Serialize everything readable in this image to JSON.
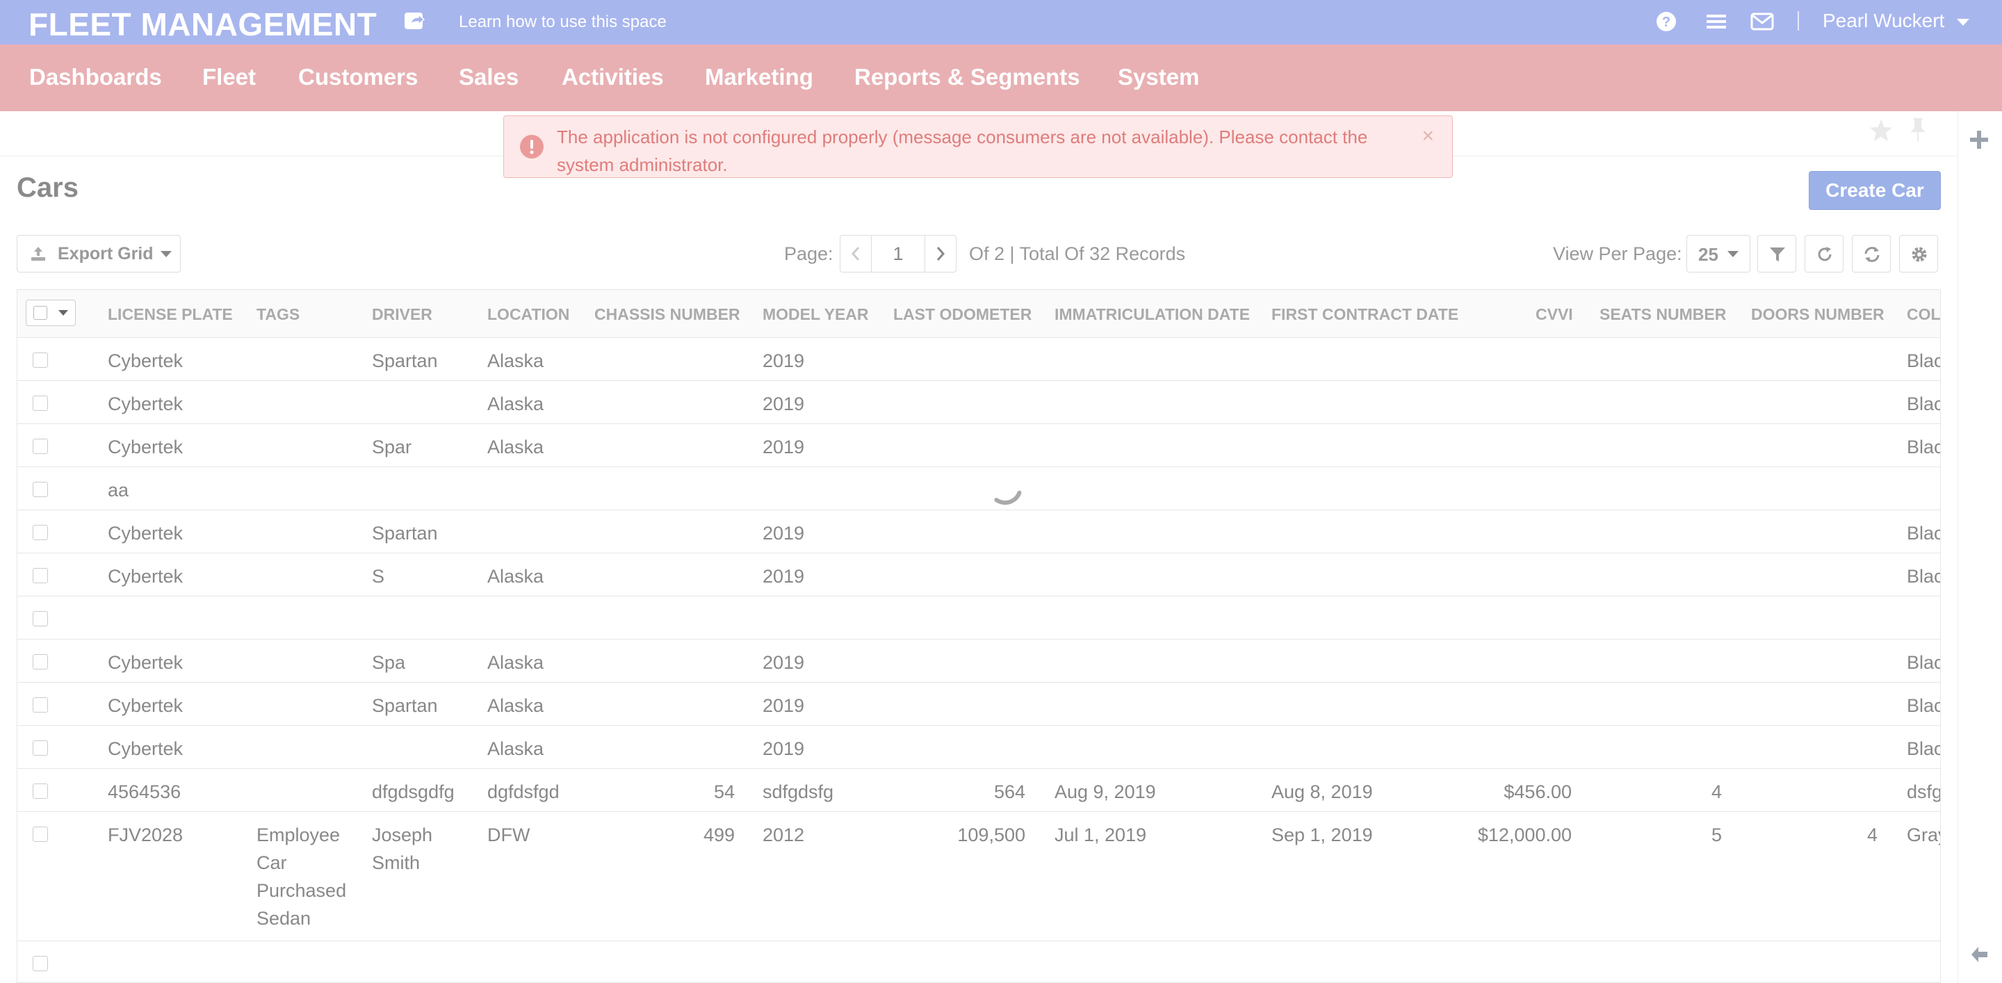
{
  "app": {
    "brand": "FLEET MANAGEMENT",
    "help_link": "Learn how to use this space",
    "user_name": "Pearl Wuckert",
    "icons": [
      "share-icon",
      "question-icon",
      "menu-icon",
      "envelope-icon",
      "caret-down-icon"
    ]
  },
  "nav": {
    "items": [
      "Dashboards",
      "Fleet",
      "Customers",
      "Sales",
      "Activities",
      "Marketing",
      "Reports & Segments",
      "System"
    ]
  },
  "alert": {
    "text": "The application is not configured properly (message consumers are not available). Please contact the system administrator.",
    "close": "×",
    "color": "#e07c7c"
  },
  "page": {
    "title": "Cars",
    "create_button": "Create Car"
  },
  "toolbar": {
    "export_label": "Export Grid",
    "page_label": "Page:",
    "page_value": "1",
    "page_total": "Of 2 | Total Of 32 Records",
    "view_per_page_label": "View Per Page:",
    "view_per_page_value": "25"
  },
  "grid": {
    "columns": [
      "LICENSE PLATE",
      "TAGS",
      "DRIVER",
      "LOCATION",
      "CHASSIS NUMBER",
      "MODEL YEAR",
      "LAST ODOMETER",
      "IMMATRICULATION DATE",
      "FIRST CONTRACT DATE",
      "CVVI",
      "SEATS NUMBER",
      "DOORS NUMBER",
      "COL"
    ],
    "rows": [
      [
        "Cybertek",
        "",
        "Spartan",
        "Alaska",
        "",
        "2019",
        "",
        "",
        "",
        "",
        "",
        "",
        "Blac"
      ],
      [
        "Cybertek",
        "",
        "",
        "Alaska",
        "",
        "2019",
        "",
        "",
        "",
        "",
        "",
        "",
        "Blac"
      ],
      [
        "Cybertek",
        "",
        "Spar",
        "Alaska",
        "",
        "2019",
        "",
        "",
        "",
        "",
        "",
        "",
        "Blac"
      ],
      [
        "aa",
        "",
        "",
        "",
        "",
        "",
        "",
        "",
        "",
        "",
        "",
        "",
        ""
      ],
      [
        "Cybertek",
        "",
        "Spartan",
        "",
        "",
        "2019",
        "",
        "",
        "",
        "",
        "",
        "",
        "Blac"
      ],
      [
        "Cybertek",
        "",
        "S",
        "Alaska",
        "",
        "2019",
        "",
        "",
        "",
        "",
        "",
        "",
        "Blac"
      ],
      [
        "",
        "",
        "",
        "",
        "",
        "",
        "",
        "",
        "",
        "",
        "",
        "",
        ""
      ],
      [
        "Cybertek",
        "",
        "Spa",
        "Alaska",
        "",
        "2019",
        "",
        "",
        "",
        "",
        "",
        "",
        "Blac"
      ],
      [
        "Cybertek",
        "",
        "Spartan",
        "Alaska",
        "",
        "2019",
        "",
        "",
        "",
        "",
        "",
        "",
        "Blac"
      ],
      [
        "Cybertek",
        "",
        "",
        "Alaska",
        "",
        "2019",
        "",
        "",
        "",
        "",
        "",
        "",
        "Blac"
      ],
      [
        "4564536",
        "",
        "dfgdsgdfg",
        "dgfdsfgd",
        "54",
        "sdfgdsfg",
        "564",
        "Aug 9, 2019",
        "Aug 8, 2019",
        "$456.00",
        "4",
        "",
        "dsfg"
      ],
      [
        "FJV2028",
        "Employee Car Purchased Sedan",
        "Joseph Smith",
        "DFW",
        "499",
        "2012",
        "109,500",
        "Jul 1, 2019",
        "Sep 1, 2019",
        "$12,000.00",
        "5",
        "4",
        "Gray"
      ],
      [
        "",
        "",
        "",
        "",
        "",
        "",
        "",
        "",
        "",
        "",
        "",
        "",
        ""
      ]
    ]
  }
}
